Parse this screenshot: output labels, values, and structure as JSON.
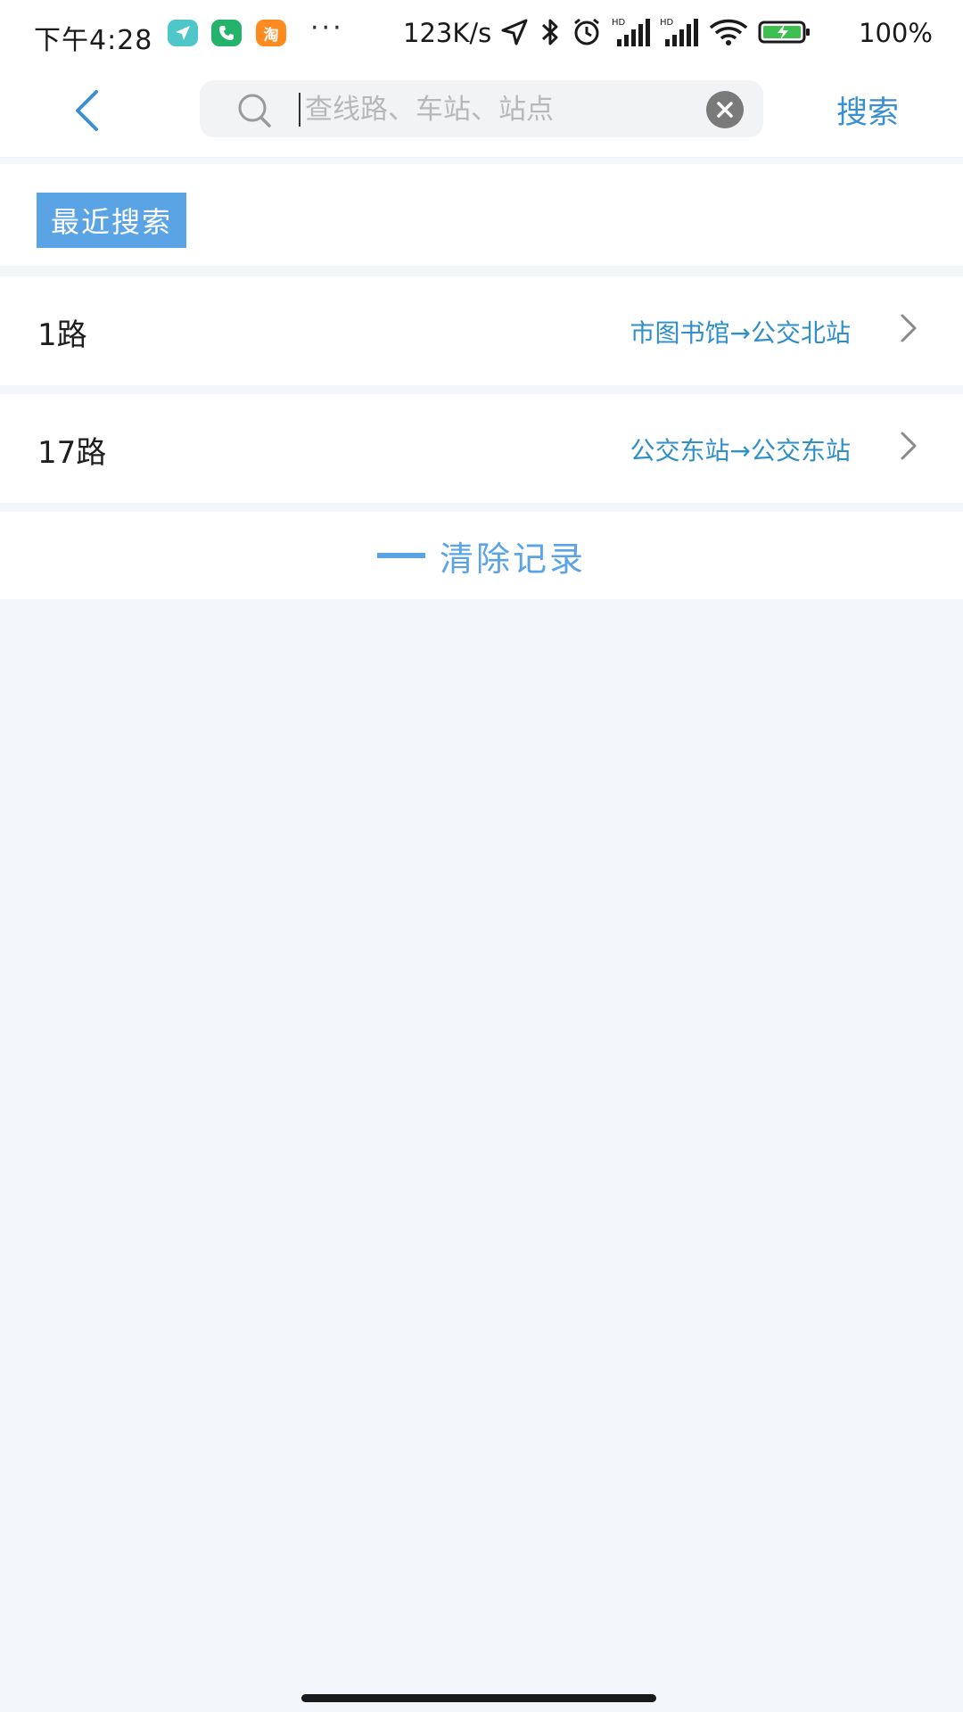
{
  "status_bar": {
    "time": "下午4:28",
    "taobao_icon_text": "淘",
    "more": "···",
    "network_speed": "123K/s",
    "battery": "100%"
  },
  "header": {
    "search_placeholder": "查线路、车站、站点",
    "search_value": "",
    "search_button": "搜索"
  },
  "recent": {
    "title": "最近搜索",
    "items": [
      {
        "name": "1路",
        "direction": "市图书馆→公交北站"
      },
      {
        "name": "17路",
        "direction": "公交东站→公交东站"
      }
    ],
    "clear_label": "清除记录"
  },
  "colors": {
    "accent": "#3a8fd0",
    "tag_bg": "#5aa3e5",
    "direction_text": "#2f8fc8",
    "page_bg": "#f3f7fb"
  }
}
